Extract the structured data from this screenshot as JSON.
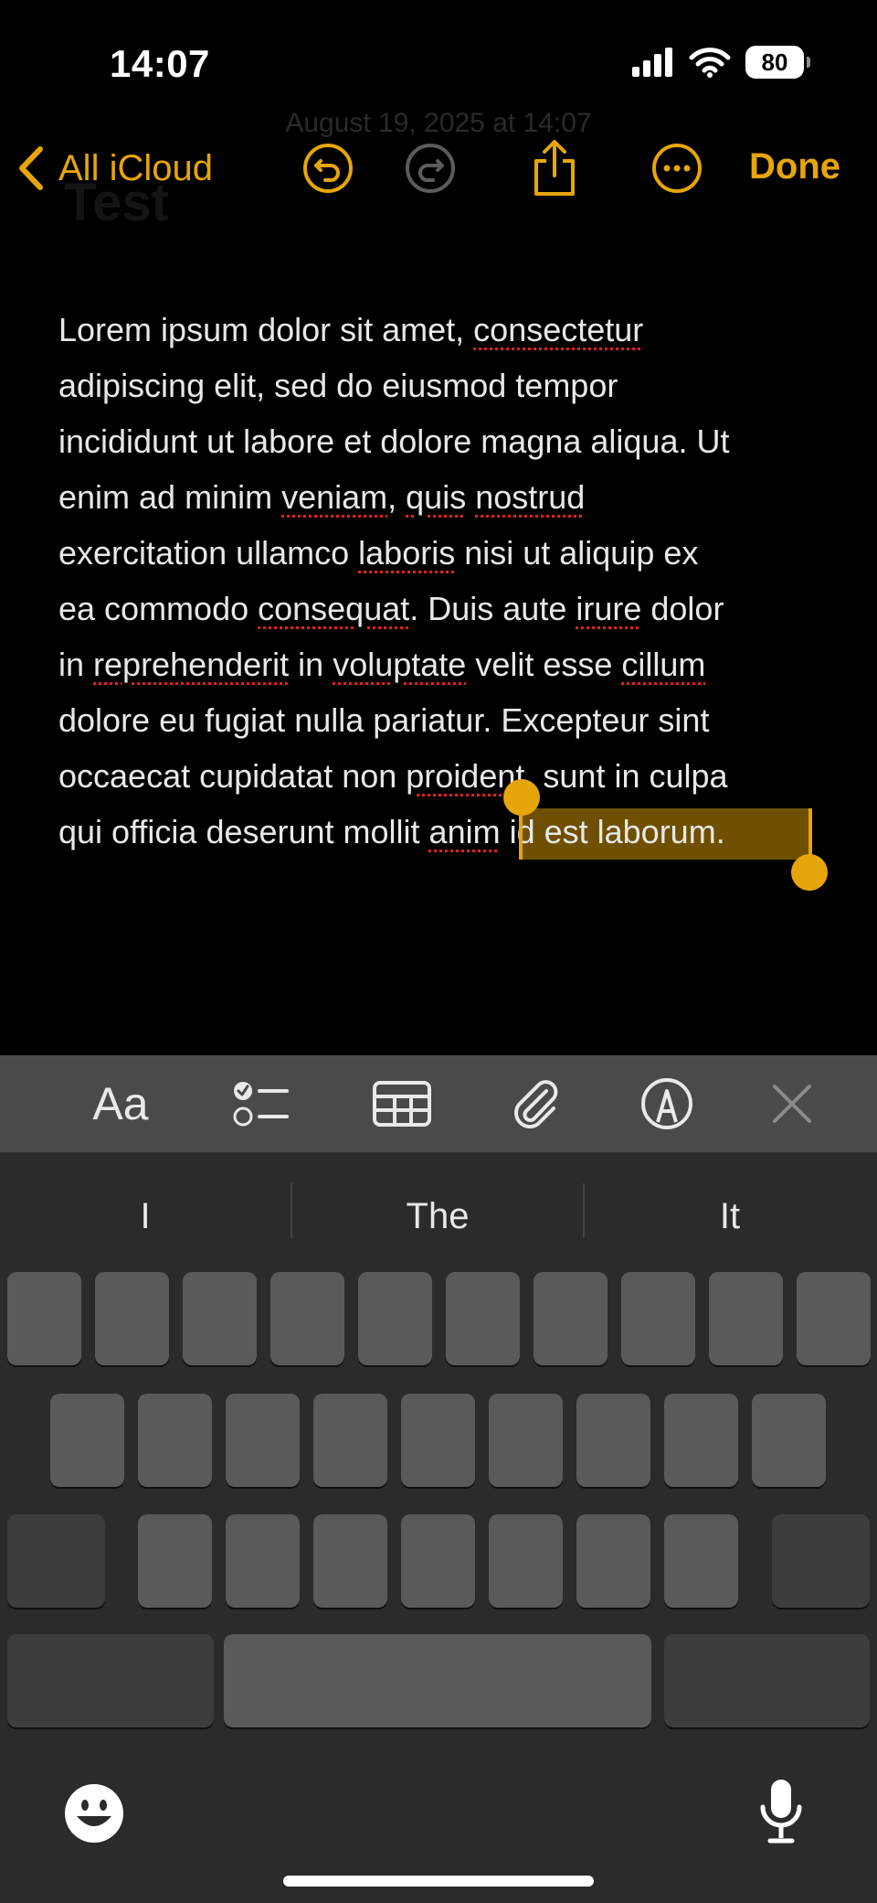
{
  "status": {
    "time": "14:07",
    "battery": "80"
  },
  "ghost": {
    "date": "August 19, 2025 at 14:07",
    "title": "Test"
  },
  "toolbar": {
    "back_label": "All iCloud",
    "done_label": "Done"
  },
  "note": {
    "lines": [
      [
        {
          "t": "Lorem ipsum dolor sit amet, "
        },
        {
          "t": "consectetur",
          "s": 1
        }
      ],
      [
        {
          "t": "adipiscing elit, sed do eiusmod tempor"
        }
      ],
      [
        {
          "t": "incididunt ut labore et dolore magna aliqua. Ut"
        }
      ],
      [
        {
          "t": "enim ad minim "
        },
        {
          "t": "veniam",
          "s": 1
        },
        {
          "t": ", "
        },
        {
          "t": "quis",
          "s": 1
        },
        {
          "t": " "
        },
        {
          "t": "nostrud",
          "s": 1
        }
      ],
      [
        {
          "t": "exercitation ullamco "
        },
        {
          "t": "laboris",
          "s": 1
        },
        {
          "t": " nisi ut aliquip ex"
        }
      ],
      [
        {
          "t": "ea commodo "
        },
        {
          "t": "consequat",
          "s": 1
        },
        {
          "t": ". Duis aute "
        },
        {
          "t": "irure",
          "s": 1
        },
        {
          "t": " dolor"
        }
      ],
      [
        {
          "t": "in "
        },
        {
          "t": "reprehenderit",
          "s": 1
        },
        {
          "t": " in "
        },
        {
          "t": "voluptate",
          "s": 1
        },
        {
          "t": " velit esse "
        },
        {
          "t": "cillum",
          "s": 1
        }
      ],
      [
        {
          "t": "dolore eu fugiat nulla pariatur. Excepteur sint"
        }
      ],
      [
        {
          "t": "occaecat cupidatat non "
        },
        {
          "t": "proident",
          "s": 1
        },
        {
          "t": ", sunt in culpa"
        }
      ],
      [
        {
          "t": "qui officia deserunt mollit "
        },
        {
          "t": "anim",
          "s": 1
        },
        {
          "t": " id est laborum."
        }
      ]
    ],
    "selected_text": "im id est laborum."
  },
  "suggestions": [
    "I",
    "The",
    "It"
  ],
  "colors": {
    "accent": "#e6a50a",
    "spellcheck": "#e02020",
    "keyboard": "#2b2b2b",
    "key": "#5a5a5a"
  }
}
